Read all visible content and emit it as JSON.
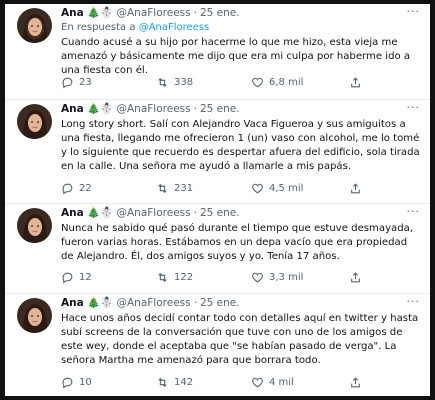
{
  "colors": {
    "link": "#1d9bf0",
    "muted": "#536471",
    "text": "#0f1419",
    "border": "#e6ecf0"
  },
  "tweets": [
    {
      "name": "Ana 🎄☃️",
      "handle": "@AnaFloreess",
      "date": "25 ene.",
      "reply_prefix": "En respuesta a",
      "reply_handle": "@AnaFloreess",
      "text": "Cuando acusé a su hijo por hacerme lo que me hizo, esta vieja me amenazó y básicamente me dijo que era mi culpa por haberme ido a una fiesta con él.",
      "replies": "23",
      "retweets": "338",
      "likes": "6,8 mil"
    },
    {
      "name": "Ana 🎄☃️",
      "handle": "@AnaFloreess",
      "date": "25 ene.",
      "text": "Long story short. Salí con Alejandro Vaca Figueroa y sus amiguitos a una fiesta, llegando me ofrecieron 1 (un) vaso con alcohol, me lo tomé y lo siguiente que recuerdo es despertar afuera del edificio, sola tirada en la calle. Una señora me ayudó a llamarle a mis papás.",
      "replies": "22",
      "retweets": "231",
      "likes": "4,5 mil"
    },
    {
      "name": "Ana 🎄☃️",
      "handle": "@AnaFloreess",
      "date": "25 ene.",
      "text": "Nunca he sabido qué pasó durante el tiempo que estuve desmayada, fueron varias horas. Estábamos en un depa vacío que era propiedad de Alejandro. Él, dos amigos suyos y yo. Tenía 17 años.",
      "replies": "12",
      "retweets": "122",
      "likes": "3,3 mil"
    },
    {
      "name": "Ana 🎄☃️",
      "handle": "@AnaFloreess",
      "date": "25 ene.",
      "text": "Hace unos años decidí contar todo con detalles aquí en twitter y hasta subí screens de la conversación que tuve con uno de los amigos de este wey, donde el aceptaba que \"se habían pasado de verga\". La señora Martha me amenazó para que borrara todo.",
      "replies": "10",
      "retweets": "142",
      "likes": "4 mil"
    }
  ]
}
